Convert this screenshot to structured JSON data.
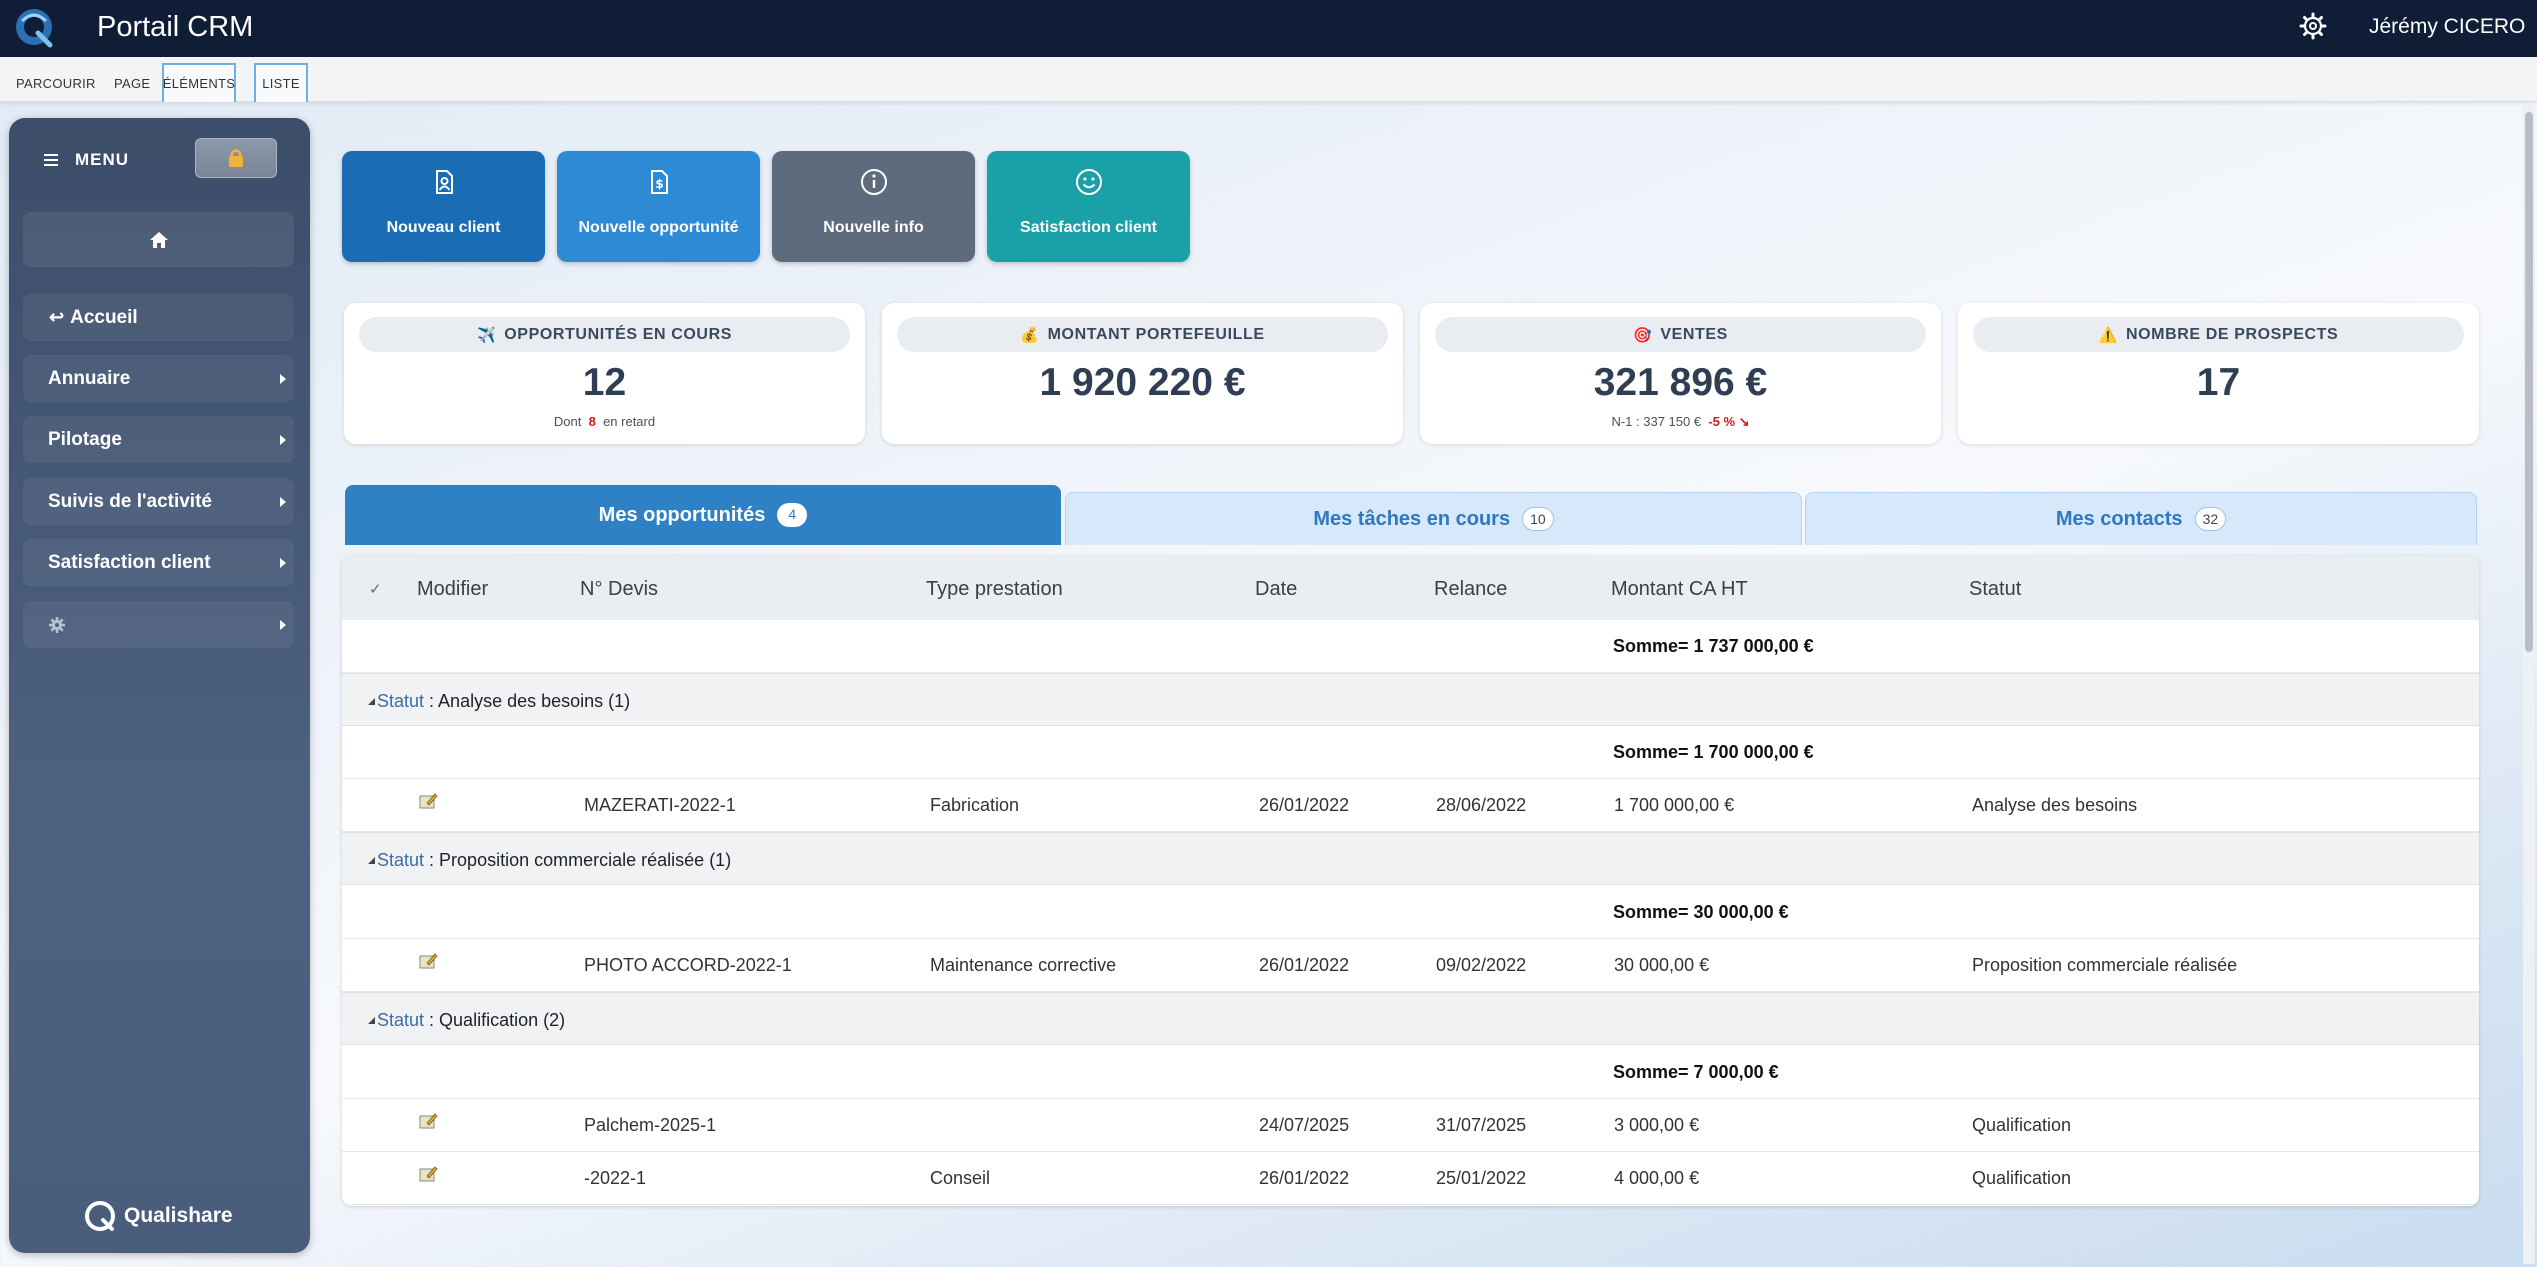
{
  "app": {
    "title": "Portail CRM",
    "user": "Jérémy CICERO"
  },
  "ribbon": {
    "tabs": [
      "PARCOURIR",
      "PAGE",
      "ÉLÉMENTS",
      "LISTE"
    ]
  },
  "sidebar": {
    "menu_label": "MENU",
    "items": [
      {
        "label": "Accueil",
        "icon": "return-arrow-icon"
      },
      {
        "label": "Annuaire"
      },
      {
        "label": "Pilotage"
      },
      {
        "label": "Suivis de l'activité"
      },
      {
        "label": "Satisfaction client"
      },
      {
        "label": "",
        "icon": "gear-icon"
      }
    ],
    "footer_brand": "Qualishare"
  },
  "tiles": [
    {
      "label": "Nouveau client",
      "icon": "contact-card-icon",
      "color": "#1a6db5"
    },
    {
      "label": "Nouvelle opportunité",
      "icon": "document-dollar-icon",
      "color": "#2f8ad6"
    },
    {
      "label": "Nouvelle info",
      "icon": "info-circle-icon",
      "color": "#5d6b7c"
    },
    {
      "label": "Satisfaction client",
      "icon": "smiley-icon",
      "color": "#1aa1a8"
    }
  ],
  "kpis": [
    {
      "title": "OPPORTUNITÉS EN COURS",
      "emoji": "✈️",
      "value": "12",
      "sub_prefix": "Dont",
      "sub_highlight": "8",
      "sub_suffix": "en retard"
    },
    {
      "title": "MONTANT PORTEFEUILLE",
      "emoji": "💰",
      "value": "1 920 220 €"
    },
    {
      "title": "VENTES",
      "emoji": "🎯",
      "value": "321 896 €",
      "sub_prefix": "N-1 : 337 150 €",
      "sub_highlight": "-5 % ↘"
    },
    {
      "title": "NOMBRE DE PROSPECTS",
      "emoji": "⚠️",
      "value": "17"
    }
  ],
  "tabs": [
    {
      "label": "Mes opportunités",
      "count": "4"
    },
    {
      "label": "Mes tâches en cours",
      "count": "10"
    },
    {
      "label": "Mes contacts",
      "count": "32"
    }
  ],
  "grid": {
    "columns": [
      "✓",
      "Modifier",
      "N° Devis",
      "Type prestation",
      "Date",
      "Relance",
      "Montant CA HT",
      "Statut"
    ],
    "total": "Somme= 1 737 000,00 €",
    "groups": [
      {
        "label": "Statut",
        "name": "Analyse des besoins",
        "count": "(1)",
        "sum": "Somme= 1 700 000,00 €",
        "rows": [
          {
            "devis": "MAZERATI-2022-1",
            "type": "Fabrication",
            "date": "26/01/2022",
            "relance": "28/06/2022",
            "montant": "1 700 000,00 €",
            "statut": "Analyse des besoins"
          }
        ]
      },
      {
        "label": "Statut",
        "name": "Proposition commerciale réalisée",
        "count": "(1)",
        "sum": "Somme= 30 000,00 €",
        "rows": [
          {
            "devis": "PHOTO ACCORD-2022-1",
            "type": "Maintenance corrective",
            "date": "26/01/2022",
            "relance": "09/02/2022",
            "montant": "30 000,00 €",
            "statut": "Proposition commerciale réalisée"
          }
        ]
      },
      {
        "label": "Statut",
        "name": "Qualification",
        "count": "(2)",
        "sum": "Somme= 7 000,00 €",
        "rows": [
          {
            "devis": "Palchem-2025-1",
            "type": "",
            "date": "24/07/2025",
            "relance": "31/07/2025",
            "montant": "3 000,00 €",
            "statut": "Qualification"
          },
          {
            "devis": "-2022-1",
            "type": "Conseil",
            "date": "26/01/2022",
            "relance": "25/01/2022",
            "montant": "4 000,00 €",
            "statut": "Qualification"
          }
        ]
      }
    ]
  }
}
